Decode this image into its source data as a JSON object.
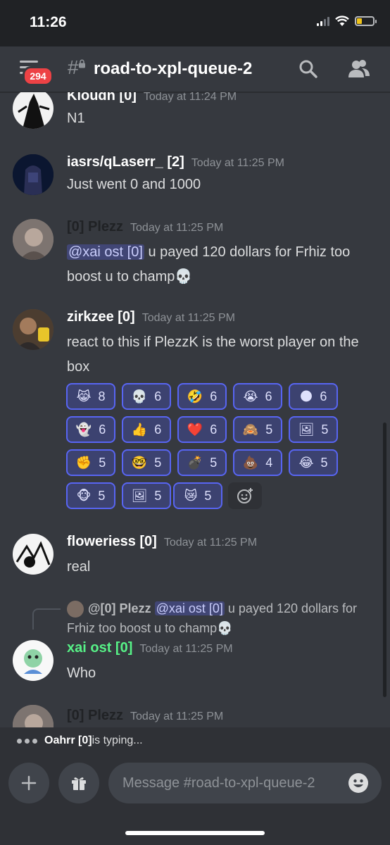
{
  "status_bar": {
    "time": "11:26"
  },
  "header": {
    "unread_badge": "294",
    "channel_name": "road-to-xpl-queue-2"
  },
  "messages": [
    {
      "author": "Kioudn [0]",
      "timestamp": "Today at 11:24 PM",
      "author_color": "#ffffff",
      "text": "N1"
    },
    {
      "author": "iasrs/qLaserr_ [2]",
      "timestamp": "Today at 11:25 PM",
      "author_color": "#ffffff",
      "text": "Just went 0 and 1000"
    },
    {
      "author": "[0] Plezz",
      "timestamp": "Today at 11:25 PM",
      "author_color": "#202225",
      "mention": "@xai ost [0]",
      "text": " u payed 120 dollars for Frhiz too boost u to champ💀"
    },
    {
      "author": "zirkzee [0]",
      "timestamp": "Today at 11:25 PM",
      "author_color": "#ffffff",
      "text": "react to this if PlezzK is the worst player on the box"
    },
    {
      "author": "floweriess [0]",
      "timestamp": "Today at 11:25 PM",
      "author_color": "#ffffff",
      "text": "real"
    },
    {
      "author": "xai ost [0]",
      "timestamp": "Today at 11:25 PM",
      "author_color": "#57f287",
      "text": "Who"
    },
    {
      "author": "[0] Plezz",
      "timestamp": "Today at 11:25 PM",
      "author_color": "#202225",
      "text": ""
    }
  ],
  "reactions": [
    {
      "emoji": "😹",
      "count": "8"
    },
    {
      "emoji": "💀",
      "count": "6"
    },
    {
      "emoji": "🤣",
      "count": "6"
    },
    {
      "emoji": "😭",
      "count": "6"
    },
    {
      "emoji": "🌑",
      "count": "6"
    },
    {
      "emoji": "👻",
      "count": "6"
    },
    {
      "emoji": "👍",
      "count": "6"
    },
    {
      "emoji": "❤️",
      "count": "6"
    },
    {
      "emoji": "🙈",
      "count": "5"
    },
    {
      "emoji": "🖼",
      "count": "5"
    },
    {
      "emoji": "✊",
      "count": "5"
    },
    {
      "emoji": "🤓",
      "count": "5"
    },
    {
      "emoji": "💣",
      "count": "5"
    },
    {
      "emoji": "💩",
      "count": "4"
    },
    {
      "emoji": "😂",
      "count": "5"
    },
    {
      "emoji": "🐵",
      "count": "5"
    },
    {
      "emoji": "🖼",
      "count": "5"
    },
    {
      "emoji": "😿",
      "count": "5"
    }
  ],
  "reply_preview": {
    "author": "@[0] Plezz",
    "mention": "@xai ost [0]",
    "text": " u payed 120 dollars for Frhiz too boost u to champ💀"
  },
  "typing": {
    "user": "Oahrr [0]",
    "suffix": " is typing..."
  },
  "composer": {
    "placeholder": "Message #road-to-xpl-queue-2"
  },
  "icons": {
    "search": "search-icon",
    "members": "members-icon",
    "add": "plus-icon",
    "gift": "gift-icon",
    "emoji": "emoji-icon",
    "add_reaction": "add-reaction-icon"
  },
  "colors": {
    "background": "#36393f",
    "accent": "#5865f2",
    "badge": "#ed4245",
    "online_green": "#57f287"
  }
}
